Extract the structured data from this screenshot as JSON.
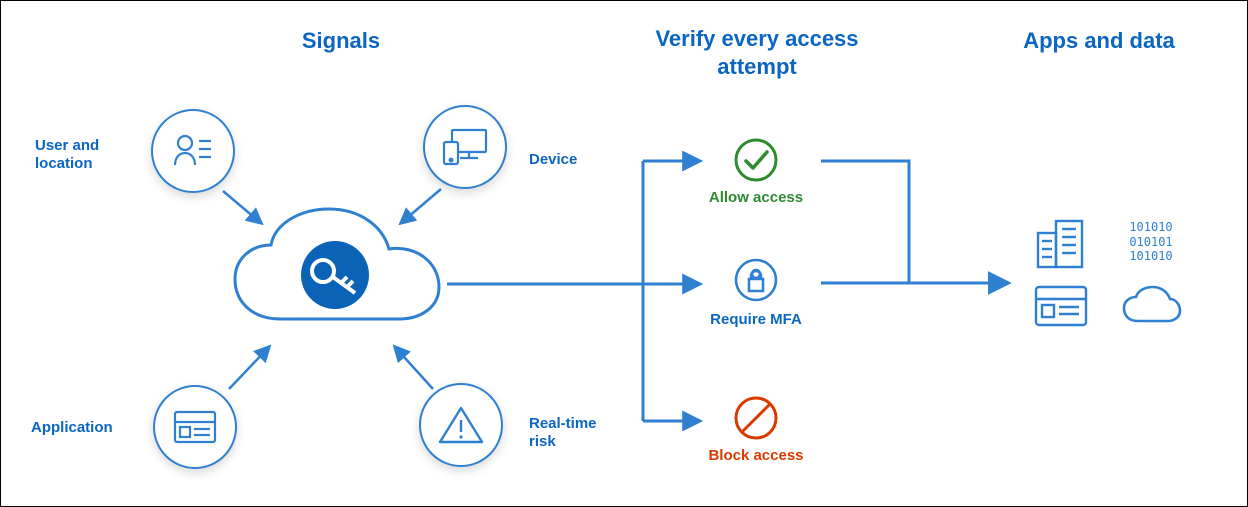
{
  "columns": {
    "signals": "Signals",
    "verify": "Verify every access\nattempt",
    "apps": "Apps and data"
  },
  "signals": {
    "user_location": "User and\nlocation",
    "device": "Device",
    "application": "Application",
    "real_time_risk": "Real-time\nrisk"
  },
  "decisions": {
    "allow": "Allow access",
    "mfa": "Require MFA",
    "block": "Block access"
  },
  "apps": {
    "binary": "101010\n010101\n101010"
  },
  "colors": {
    "blue": "#2f80d0",
    "green": "#2e8b30",
    "red": "#d83b01"
  }
}
